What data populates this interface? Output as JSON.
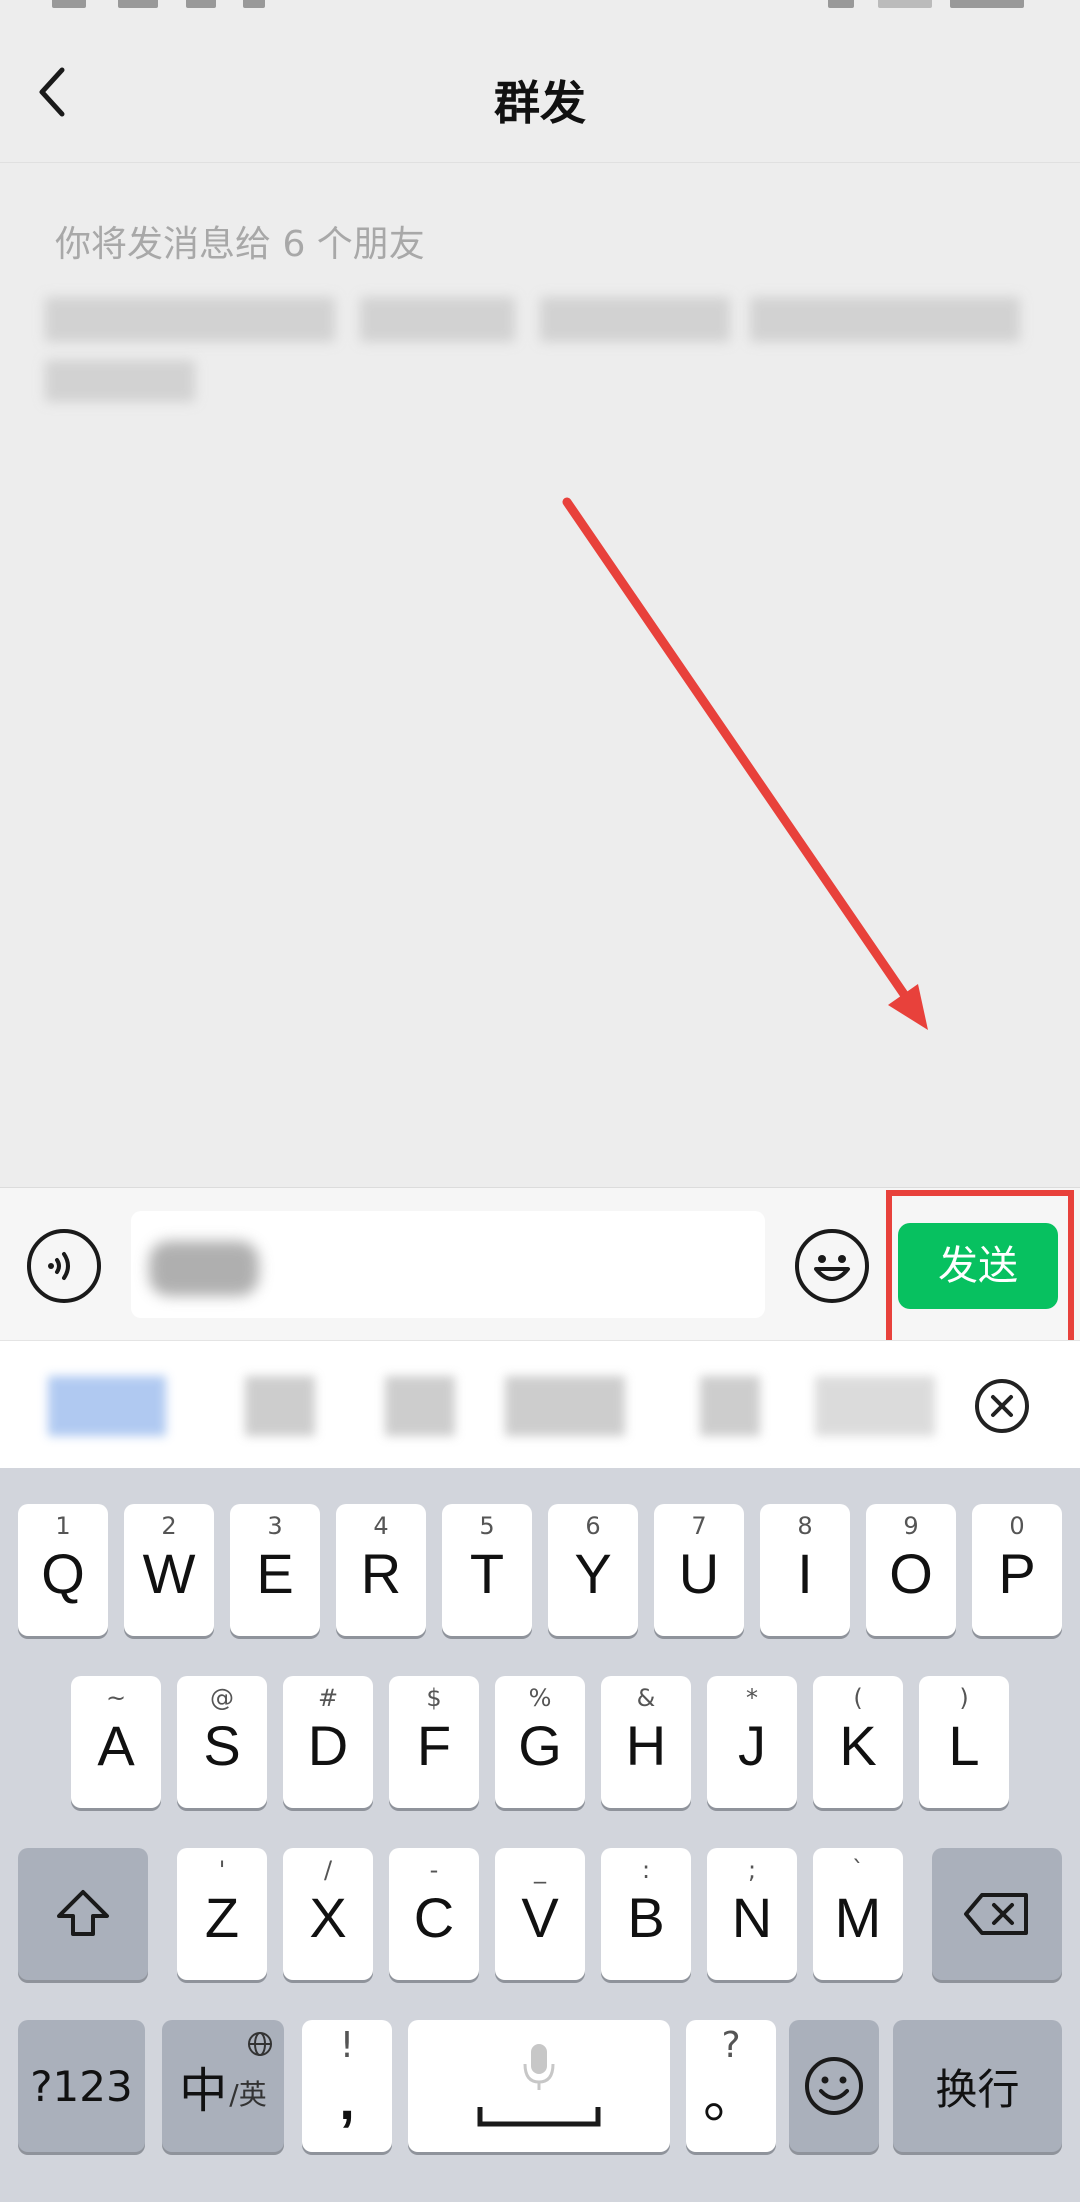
{
  "nav": {
    "title": "群发"
  },
  "message": {
    "recipients_info": "你将发消息给 6 个朋友"
  },
  "input_bar": {
    "send_label": "发送"
  },
  "keyboard": {
    "row1": [
      {
        "letter": "Q",
        "sub": "1"
      },
      {
        "letter": "W",
        "sub": "2"
      },
      {
        "letter": "E",
        "sub": "3"
      },
      {
        "letter": "R",
        "sub": "4"
      },
      {
        "letter": "T",
        "sub": "5"
      },
      {
        "letter": "Y",
        "sub": "6"
      },
      {
        "letter": "U",
        "sub": "7"
      },
      {
        "letter": "I",
        "sub": "8"
      },
      {
        "letter": "O",
        "sub": "9"
      },
      {
        "letter": "P",
        "sub": "0"
      }
    ],
    "row2": [
      {
        "letter": "A",
        "sub": "~"
      },
      {
        "letter": "S",
        "sub": "@"
      },
      {
        "letter": "D",
        "sub": "#"
      },
      {
        "letter": "F",
        "sub": "$"
      },
      {
        "letter": "G",
        "sub": "%"
      },
      {
        "letter": "H",
        "sub": "&"
      },
      {
        "letter": "J",
        "sub": "*"
      },
      {
        "letter": "K",
        "sub": "("
      },
      {
        "letter": "L",
        "sub": ")"
      }
    ],
    "row3": [
      {
        "letter": "Z",
        "sub": "'"
      },
      {
        "letter": "X",
        "sub": "/"
      },
      {
        "letter": "C",
        "sub": "-"
      },
      {
        "letter": "V",
        "sub": "_"
      },
      {
        "letter": "B",
        "sub": ":"
      },
      {
        "letter": "N",
        "sub": ";"
      },
      {
        "letter": "M",
        "sub": "`"
      }
    ],
    "symbols_key": "?123",
    "lang_key_main": "中",
    "lang_key_alt": "/英",
    "comma_key": ",",
    "comma_alt": "!",
    "period_key": "。",
    "period_alt": "?",
    "enter_key": "换行"
  },
  "icons": {
    "back": "chevron-left-icon",
    "voice": "voice-icon",
    "emoji": "smile-icon",
    "clear": "close-circle-icon",
    "shift": "shift-icon",
    "backspace": "backspace-icon",
    "globe": "globe-icon",
    "mic": "mic-icon"
  },
  "colors": {
    "send_button": "#07c160",
    "annotation": "#e8413b",
    "background": "#ededed",
    "keyboard": "#d2d5dc"
  }
}
